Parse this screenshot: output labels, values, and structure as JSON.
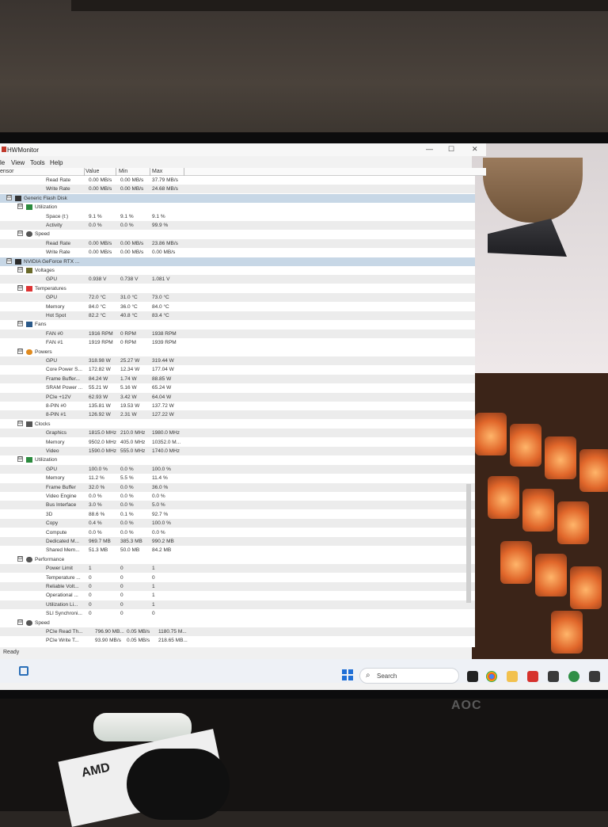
{
  "window": {
    "title": "HWMonitor",
    "menu": [
      "le",
      "View",
      "Tools",
      "Help"
    ],
    "controls": {
      "minimize": "—",
      "maximize": "☐",
      "close": "✕"
    }
  },
  "columns": {
    "sensor": "ensor",
    "value": "Value",
    "min": "Min",
    "max": "Max"
  },
  "rows": [
    {
      "indent": 3,
      "label": "Read Rate",
      "value": "0.00 MB/s",
      "min": "0.00 MB/s",
      "max": "37.79 MB/s",
      "style": ""
    },
    {
      "indent": 3,
      "label": "Write Rate",
      "value": "0.00 MB/s",
      "min": "0.00 MB/s",
      "max": "24.68 MB/s",
      "style": "alt"
    },
    {
      "indent": 1,
      "label": "Generic Flash Disk",
      "value": "",
      "min": "",
      "max": "",
      "style": "device",
      "icon": "disk",
      "expander": "⊟"
    },
    {
      "indent": 2,
      "label": "Utilization",
      "value": "",
      "min": "",
      "max": "",
      "style": "",
      "icon": "util",
      "expander": "⊟"
    },
    {
      "indent": 3,
      "label": "Space (t:)",
      "value": "9.1 %",
      "min": "9.1 %",
      "max": "9.1 %",
      "style": ""
    },
    {
      "indent": 3,
      "label": "Activity",
      "value": "0.0 %",
      "min": "0.0 %",
      "max": "99.9 %",
      "style": "alt"
    },
    {
      "indent": 2,
      "label": "Speed",
      "value": "",
      "min": "",
      "max": "",
      "style": "",
      "icon": "speed",
      "expander": "⊟"
    },
    {
      "indent": 3,
      "label": "Read Rate",
      "value": "0.00 MB/s",
      "min": "0.00 MB/s",
      "max": "23.86 MB/s",
      "style": "alt"
    },
    {
      "indent": 3,
      "label": "Write Rate",
      "value": "0.00 MB/s",
      "min": "0.00 MB/s",
      "max": "0.00 MB/s",
      "style": ""
    },
    {
      "indent": 1,
      "label": "NVIDIA GeForce RTX ...",
      "value": "",
      "min": "",
      "max": "",
      "style": "device",
      "icon": "gpu",
      "expander": "⊟"
    },
    {
      "indent": 2,
      "label": "Voltages",
      "value": "",
      "min": "",
      "max": "",
      "style": "",
      "icon": "volt",
      "expander": "⊟"
    },
    {
      "indent": 3,
      "label": "GPU",
      "value": "0.938 V",
      "min": "0.738 V",
      "max": "1.081 V",
      "style": "alt"
    },
    {
      "indent": 2,
      "label": "Temperatures",
      "value": "",
      "min": "",
      "max": "",
      "style": "",
      "icon": "temp",
      "expander": "⊟"
    },
    {
      "indent": 3,
      "label": "GPU",
      "value": "72.0 °C",
      "min": "31.0 °C",
      "max": "73.0 °C",
      "style": "alt"
    },
    {
      "indent": 3,
      "label": "Memory",
      "value": "84.0 °C",
      "min": "36.0 °C",
      "max": "84.0 °C",
      "style": ""
    },
    {
      "indent": 3,
      "label": "Hot Spot",
      "value": "82.2 °C",
      "min": "40.8 °C",
      "max": "83.4 °C",
      "style": "alt"
    },
    {
      "indent": 2,
      "label": "Fans",
      "value": "",
      "min": "",
      "max": "",
      "style": "",
      "icon": "fan",
      "expander": "⊟"
    },
    {
      "indent": 3,
      "label": "FAN #0",
      "value": "1916 RPM",
      "min": "0 RPM",
      "max": "1938 RPM",
      "style": "alt"
    },
    {
      "indent": 3,
      "label": "FAN #1",
      "value": "1919 RPM",
      "min": "0 RPM",
      "max": "1939 RPM",
      "style": ""
    },
    {
      "indent": 2,
      "label": "Powers",
      "value": "",
      "min": "",
      "max": "",
      "style": "",
      "icon": "power",
      "expander": "⊟"
    },
    {
      "indent": 3,
      "label": "GPU",
      "value": "318.98 W",
      "min": "25.27 W",
      "max": "319.44 W",
      "style": "alt"
    },
    {
      "indent": 3,
      "label": "Core Power S...",
      "value": "172.82 W",
      "min": "12.34 W",
      "max": "177.04 W",
      "style": ""
    },
    {
      "indent": 3,
      "label": "Frame Buffer...",
      "value": "84.24 W",
      "min": "1.74 W",
      "max": "88.85 W",
      "style": "alt"
    },
    {
      "indent": 3,
      "label": "SRAM Power ...",
      "value": "55.21 W",
      "min": "5.16 W",
      "max": "65.24 W",
      "style": ""
    },
    {
      "indent": 3,
      "label": "PCIe +12V",
      "value": "62.93 W",
      "min": "3.42 W",
      "max": "64.04 W",
      "style": "alt"
    },
    {
      "indent": 3,
      "label": "8-PIN #0",
      "value": "135.81 W",
      "min": "19.53 W",
      "max": "137.72 W",
      "style": ""
    },
    {
      "indent": 3,
      "label": "8-PIN #1",
      "value": "126.92 W",
      "min": "2.31 W",
      "max": "127.22 W",
      "style": "alt"
    },
    {
      "indent": 2,
      "label": "Clocks",
      "value": "",
      "min": "",
      "max": "",
      "style": "",
      "icon": "clock",
      "expander": "⊟"
    },
    {
      "indent": 3,
      "label": "Graphics",
      "value": "1815.0 MHz",
      "min": "210.0 MHz",
      "max": "1980.0 MHz",
      "style": "alt"
    },
    {
      "indent": 3,
      "label": "Memory",
      "value": "9502.0 MHz",
      "min": "405.0 MHz",
      "max": "10352.0 M...",
      "style": ""
    },
    {
      "indent": 3,
      "label": "Video",
      "value": "1590.0 MHz",
      "min": "555.0 MHz",
      "max": "1740.0 MHz",
      "style": "alt"
    },
    {
      "indent": 2,
      "label": "Utilization",
      "value": "",
      "min": "",
      "max": "",
      "style": "",
      "icon": "util",
      "expander": "⊟"
    },
    {
      "indent": 3,
      "label": "GPU",
      "value": "100.0 %",
      "min": "0.0 %",
      "max": "100.0 %",
      "style": "alt"
    },
    {
      "indent": 3,
      "label": "Memory",
      "value": "11.2 %",
      "min": "5.5 %",
      "max": "11.4 %",
      "style": ""
    },
    {
      "indent": 3,
      "label": "Frame Buffer",
      "value": "32.0 %",
      "min": "0.0 %",
      "max": "36.0 %",
      "style": "alt"
    },
    {
      "indent": 3,
      "label": "Video Engine",
      "value": "0.0 %",
      "min": "0.0 %",
      "max": "0.0 %",
      "style": ""
    },
    {
      "indent": 3,
      "label": "Bus Interface",
      "value": "3.0 %",
      "min": "0.0 %",
      "max": "5.0 %",
      "style": "alt"
    },
    {
      "indent": 3,
      "label": "3D",
      "value": "88.6 %",
      "min": "0.1 %",
      "max": "92.7 %",
      "style": ""
    },
    {
      "indent": 3,
      "label": "Copy",
      "value": "0.4 %",
      "min": "0.0 %",
      "max": "100.0 %",
      "style": "alt"
    },
    {
      "indent": 3,
      "label": "Compute",
      "value": "0.0 %",
      "min": "0.0 %",
      "max": "0.0 %",
      "style": ""
    },
    {
      "indent": 3,
      "label": "Dedicated M...",
      "value": "969.7 MB",
      "min": "385.3 MB",
      "max": "990.2 MB",
      "style": "alt"
    },
    {
      "indent": 3,
      "label": "Shared Mem...",
      "value": "51.3 MB",
      "min": "50.0 MB",
      "max": "84.2 MB",
      "style": ""
    },
    {
      "indent": 2,
      "label": "Performance",
      "value": "",
      "min": "",
      "max": "",
      "style": "",
      "icon": "speed",
      "expander": "⊟"
    },
    {
      "indent": 3,
      "label": "Power Limit",
      "value": "1",
      "min": "0",
      "max": "1",
      "style": "alt"
    },
    {
      "indent": 3,
      "label": "Temperature ...",
      "value": "0",
      "min": "0",
      "max": "0",
      "style": ""
    },
    {
      "indent": 3,
      "label": "Reliable Volt...",
      "value": "0",
      "min": "0",
      "max": "1",
      "style": "alt"
    },
    {
      "indent": 3,
      "label": "Operational ...",
      "value": "0",
      "min": "0",
      "max": "1",
      "style": ""
    },
    {
      "indent": 3,
      "label": "Utilization Li...",
      "value": "0",
      "min": "0",
      "max": "1",
      "style": "alt"
    },
    {
      "indent": 3,
      "label": "SLI Synchroni...",
      "value": "0",
      "min": "0",
      "max": "0",
      "style": ""
    },
    {
      "indent": 2,
      "label": "Speed",
      "value": "",
      "min": "",
      "max": "",
      "style": "",
      "icon": "speed",
      "expander": "⊟"
    },
    {
      "indent": 3,
      "label": "PCIe Read Th...",
      "value": "796.90 MB...",
      "min": "0.05 MB/s",
      "max": "1180.75 M...",
      "style": "alt"
    },
    {
      "indent": 3,
      "label": "PCIe Write T...",
      "value": "93.90 MB/s",
      "min": "0.05 MB/s",
      "max": "218.65 MB...",
      "style": ""
    }
  ],
  "status": "Ready",
  "taskbar": {
    "search_label": "Search"
  },
  "colors": {
    "device_row": "#c7d7e6",
    "alt_row": "#ececec",
    "start_blue": "#1f6fd6"
  },
  "monitor_brand": "AOC",
  "box_text": "AMD"
}
